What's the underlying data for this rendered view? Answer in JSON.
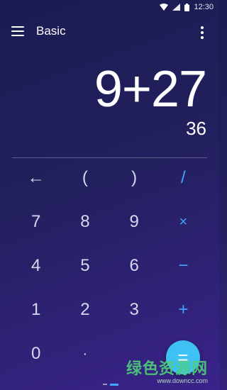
{
  "status_bar": {
    "time": "12:30",
    "icons": [
      "wifi-icon",
      "signal-icon",
      "battery-icon"
    ]
  },
  "toolbar": {
    "title": "Basic",
    "menu_icon": "hamburger-menu-icon",
    "more_icon": "more-vert-icon"
  },
  "display": {
    "expression": "9+27",
    "result": "36"
  },
  "keypad": {
    "rows": [
      [
        "←",
        "(",
        ")",
        "/"
      ],
      [
        "7",
        "8",
        "9",
        "×"
      ],
      [
        "4",
        "5",
        "6",
        "−"
      ],
      [
        "1",
        "2",
        "3",
        "+"
      ],
      [
        "0",
        "·",
        "",
        ""
      ]
    ]
  },
  "equals": {
    "label": "="
  },
  "pager": {
    "pages": 2,
    "active": 2
  },
  "watermark": {
    "text": "绿色资源网",
    "url": "www.downcc.com"
  },
  "colors": {
    "background_top": "#1b1c52",
    "background_bottom": "#3a238a",
    "operator": "#3fa5ff",
    "equals_fab": "#3ec1f3",
    "digit": "#d6d8f0"
  }
}
